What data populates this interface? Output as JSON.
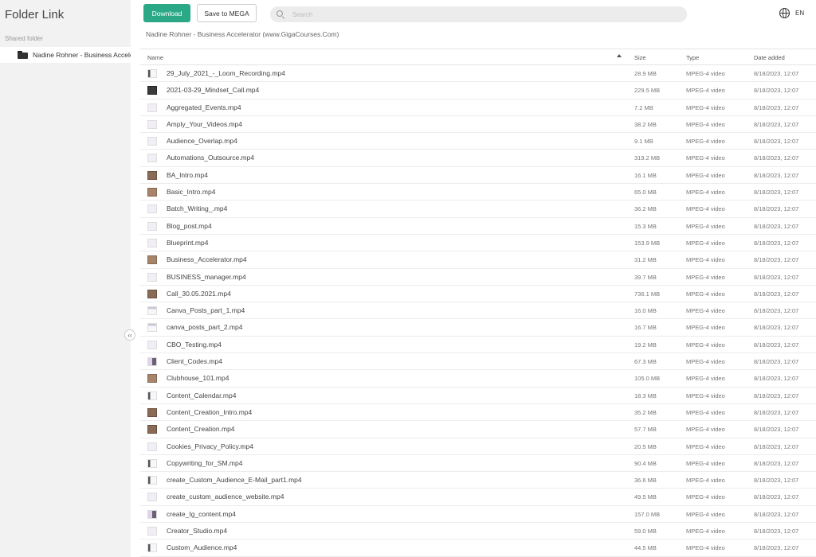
{
  "sidebar": {
    "title": "Folder Link",
    "section_label": "Shared folder",
    "folder_label": "Nadine Rohner - Business Accelerator (www.GigaCourses.Com)"
  },
  "toolbar": {
    "download_label": "Download",
    "save_label": "Save to MEGA",
    "search_placeholder": "Search",
    "lang_label": "EN"
  },
  "breadcrumb": "Nadine Rohner - Business Accelerator (www.GigaCourses.Com)",
  "table": {
    "columns": {
      "name": "Name",
      "size": "Size",
      "type": "Type",
      "date": "Date added"
    },
    "rows": [
      {
        "name": "29_July_2021_-_Loom_Recording.mp4",
        "size": "28.9 MB",
        "type": "MPEG-4 video",
        "date": "8/18/2023, 12:07",
        "thumb": "bar"
      },
      {
        "name": "2021-03-29_Mindset_Call.mp4",
        "size": "229.5 MB",
        "type": "MPEG-4 video",
        "date": "8/18/2023, 12:07",
        "thumb": "dark"
      },
      {
        "name": "Aggregated_Events.mp4",
        "size": "7.2 MB",
        "type": "MPEG-4 video",
        "date": "8/18/2023, 12:07",
        "thumb": "plain"
      },
      {
        "name": "Amply_Your_Videos.mp4",
        "size": "38.2 MB",
        "type": "MPEG-4 video",
        "date": "8/18/2023, 12:07",
        "thumb": "plain"
      },
      {
        "name": "Audience_Overlap.mp4",
        "size": "9.1 MB",
        "type": "MPEG-4 video",
        "date": "8/18/2023, 12:07",
        "thumb": "plain"
      },
      {
        "name": "Automations_Outsource.mp4",
        "size": "319.2 MB",
        "type": "MPEG-4 video",
        "date": "8/18/2023, 12:07",
        "thumb": "plain"
      },
      {
        "name": "BA_Intro.mp4",
        "size": "16.1 MB",
        "type": "MPEG-4 video",
        "date": "8/18/2023, 12:07",
        "thumb": "photo"
      },
      {
        "name": "Basic_Intro.mp4",
        "size": "65.0 MB",
        "type": "MPEG-4 video",
        "date": "8/18/2023, 12:07",
        "thumb": "brown"
      },
      {
        "name": "Batch_Writing_.mp4",
        "size": "36.2 MB",
        "type": "MPEG-4 video",
        "date": "8/18/2023, 12:07",
        "thumb": "plain"
      },
      {
        "name": "Blog_post.mp4",
        "size": "15.3 MB",
        "type": "MPEG-4 video",
        "date": "8/18/2023, 12:07",
        "thumb": "plain"
      },
      {
        "name": "Blueprint.mp4",
        "size": "153.9 MB",
        "type": "MPEG-4 video",
        "date": "8/18/2023, 12:07",
        "thumb": "plain"
      },
      {
        "name": "Business_Accelerator.mp4",
        "size": "31.2 MB",
        "type": "MPEG-4 video",
        "date": "8/18/2023, 12:07",
        "thumb": "brown"
      },
      {
        "name": "BUSINESS_manager.mp4",
        "size": "39.7 MB",
        "type": "MPEG-4 video",
        "date": "8/18/2023, 12:07",
        "thumb": "plain"
      },
      {
        "name": "Call_30.05.2021.mp4",
        "size": "736.1 MB",
        "type": "MPEG-4 video",
        "date": "8/18/2023, 12:07",
        "thumb": "photo"
      },
      {
        "name": "Canva_Posts_part_1.mp4",
        "size": "16.0 MB",
        "type": "MPEG-4 video",
        "date": "8/18/2023, 12:07",
        "thumb": "sheet"
      },
      {
        "name": "canva_posts_part_2.mp4",
        "size": "16.7 MB",
        "type": "MPEG-4 video",
        "date": "8/18/2023, 12:07",
        "thumb": "sheet"
      },
      {
        "name": "CBO_Testing.mp4",
        "size": "19.2 MB",
        "type": "MPEG-4 video",
        "date": "8/18/2023, 12:07",
        "thumb": "plain"
      },
      {
        "name": "Client_Codes.mp4",
        "size": "67.3 MB",
        "type": "MPEG-4 video",
        "date": "8/18/2023, 12:07",
        "thumb": "mix"
      },
      {
        "name": "Clubhouse_101.mp4",
        "size": "105.0 MB",
        "type": "MPEG-4 video",
        "date": "8/18/2023, 12:07",
        "thumb": "brown"
      },
      {
        "name": "Content_Calendar.mp4",
        "size": "18.3 MB",
        "type": "MPEG-4 video",
        "date": "8/18/2023, 12:07",
        "thumb": "bar"
      },
      {
        "name": "Content_Creation_Intro.mp4",
        "size": "35.2 MB",
        "type": "MPEG-4 video",
        "date": "8/18/2023, 12:07",
        "thumb": "photo"
      },
      {
        "name": "Content_Creation.mp4",
        "size": "57.7 MB",
        "type": "MPEG-4 video",
        "date": "8/18/2023, 12:07",
        "thumb": "photo"
      },
      {
        "name": "Cookies_Privacy_Policy.mp4",
        "size": "20.5 MB",
        "type": "MPEG-4 video",
        "date": "8/18/2023, 12:07",
        "thumb": "plain"
      },
      {
        "name": "Copywriting_for_SM.mp4",
        "size": "90.4 MB",
        "type": "MPEG-4 video",
        "date": "8/18/2023, 12:07",
        "thumb": "bar"
      },
      {
        "name": "create_Custom_Audience_E-Mail_part1.mp4",
        "size": "36.6 MB",
        "type": "MPEG-4 video",
        "date": "8/18/2023, 12:07",
        "thumb": "bar"
      },
      {
        "name": "create_custom_audience_website.mp4",
        "size": "49.5 MB",
        "type": "MPEG-4 video",
        "date": "8/18/2023, 12:07",
        "thumb": "plain"
      },
      {
        "name": "create_Ig_content.mp4",
        "size": "157.0 MB",
        "type": "MPEG-4 video",
        "date": "8/18/2023, 12:07",
        "thumb": "mix"
      },
      {
        "name": "Creator_Studio.mp4",
        "size": "59.0 MB",
        "type": "MPEG-4 video",
        "date": "8/18/2023, 12:07",
        "thumb": "plain"
      },
      {
        "name": "Custom_Audience.mp4",
        "size": "44.5 MB",
        "type": "MPEG-4 video",
        "date": "8/18/2023, 12:07",
        "thumb": "bar"
      }
    ]
  }
}
